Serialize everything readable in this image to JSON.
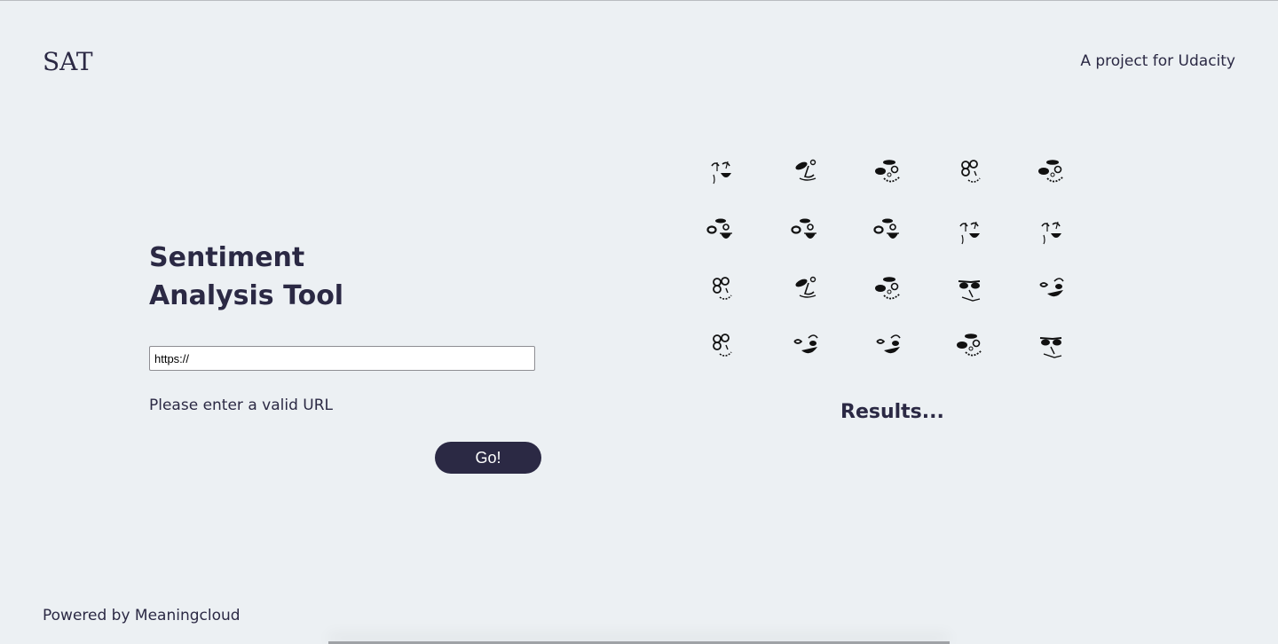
{
  "header": {
    "logo": "SAT",
    "tagline": "A project for Udacity"
  },
  "form": {
    "title_line1": "Sentiment",
    "title_line2": "Analysis Tool",
    "url_value": "https://",
    "hint": "Please enter a valid URL",
    "submit_label": "Go!"
  },
  "results": {
    "label": "Results..."
  },
  "face_grid": {
    "rows": [
      [
        "face-grin-icon",
        "face-wink-icon",
        "face-dizzy-icon",
        "face-goggle-icon",
        "face-dizzy-icon"
      ],
      [
        "face-laugh-icon",
        "face-laugh-icon",
        "face-laugh-icon",
        "face-grin-icon",
        "face-grin-icon"
      ],
      [
        "face-goggle-icon",
        "face-wink-icon",
        "face-dizzy-icon",
        "face-stern-icon",
        "face-smirk-icon"
      ],
      [
        "face-goggle-icon",
        "face-smirk-icon",
        "face-smirk-icon",
        "face-dizzy-icon",
        "face-stern-icon"
      ]
    ]
  },
  "footer": {
    "text": "Powered by Meaningcloud"
  }
}
